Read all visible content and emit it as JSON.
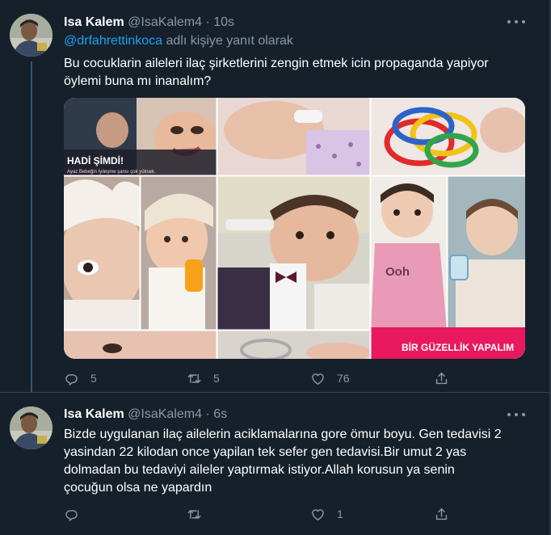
{
  "tweets": [
    {
      "name": "Isa Kalem",
      "handle": "@IsaKalem4",
      "separator": "·",
      "time": "10s",
      "reply_mention": "@drfahrettinkoca",
      "reply_suffix": " adlı kişiye yanıt olarak",
      "text_line1": "Bu cocuklarin aileleri ilaç şirketlerini zengin etmek icin propaganda yapiyor",
      "text_line2": "öylemi buna mı inanalım?",
      "media": {
        "banner_top": "HADİ ŞİMDİ!",
        "banner_sub": "Ayaz Bebeğin İyileşme şansı çok yüksek.",
        "banner_bottom": "BİR GÜZELLİK YAPALIM",
        "shirt_text": "Ooh"
      },
      "replies": "5",
      "retweets": "5",
      "likes": "76"
    },
    {
      "name": "Isa Kalem",
      "handle": "@IsaKalem4",
      "separator": "·",
      "time": "6s",
      "text_line1": "Bizde uygulanan ilaç ailelerin aciklamalarına gore ömur boyu. Gen tedavisi 2",
      "text_line2": "yasindan 22 kilodan once yapilan tek sefer gen tedavisi.Bir umut 2 yas",
      "text_line3": "dolmadan bu tedaviyi aileler yaptırmak istiyor.Allah korusun ya senin",
      "text_line4": "çocuğun olsa ne yapardın",
      "replies": "",
      "retweets": "",
      "likes": "1"
    }
  ],
  "icons": [
    "more-icon",
    "reply-icon",
    "retweet-icon",
    "like-icon",
    "share-icon"
  ],
  "colors": {
    "background": "#15202b",
    "secondary_text": "#8899a6",
    "link": "#1da1f2",
    "divider": "#38444d",
    "banner_pink": "#e8195f"
  }
}
